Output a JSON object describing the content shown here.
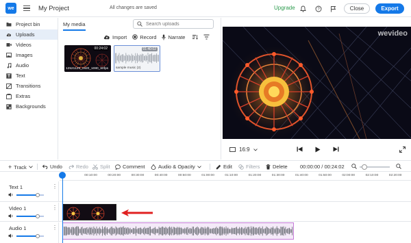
{
  "app": {
    "logo_text": "we",
    "project_title": "My Project",
    "save_status": "All changes are saved",
    "upgrade_label": "Upgrade",
    "close_label": "Close",
    "export_label": "Export"
  },
  "sidebar": {
    "items": [
      {
        "label": "Project bin",
        "icon": "folder-icon",
        "active": false
      },
      {
        "label": "Uploads",
        "icon": "upload-cloud-icon",
        "active": true
      },
      {
        "label": "Videos",
        "icon": "video-icon",
        "active": false
      },
      {
        "label": "Images",
        "icon": "image-icon",
        "active": false
      },
      {
        "label": "Audio",
        "icon": "music-note-icon",
        "active": false
      },
      {
        "label": "Text",
        "icon": "text-icon",
        "active": false
      },
      {
        "label": "Transitions",
        "icon": "transitions-icon",
        "active": false
      },
      {
        "label": "Extras",
        "icon": "extras-icon",
        "active": false
      },
      {
        "label": "Backgrounds",
        "icon": "backgrounds-icon",
        "active": false
      }
    ]
  },
  "media": {
    "tab_label": "My media",
    "search_placeholder": "Search uploads",
    "actions": {
      "import": "Import",
      "record": "Record",
      "narrate": "Narrate"
    },
    "items": [
      {
        "name": "12521129_1920_1080_60fps",
        "duration": "00:24:02",
        "type": "video"
      },
      {
        "name": "sample music (2)",
        "duration": "01:40:02",
        "type": "audio"
      }
    ]
  },
  "preview": {
    "watermark": "wevideo",
    "aspect_ratio": "16:9"
  },
  "timeline_toolbar": {
    "track": "Track",
    "undo": "Undo",
    "redo": "Redo",
    "split": "Split",
    "comment": "Comment",
    "audio_opacity": "Audio & Opacity",
    "edit": "Edit",
    "filters": "Filters",
    "delete": "Delete",
    "timecode": "00:00:00 / 00:24:02"
  },
  "ruler": {
    "ticks": [
      "00",
      "00:10:00",
      "00:20:00",
      "00:30:00",
      "00:40:00",
      "00:50:00",
      "01:00:00",
      "01:10:00",
      "01:20:00",
      "01:30:00",
      "01:40:00",
      "01:50:00",
      "02:00:00",
      "02:10:00",
      "02:20:00"
    ]
  },
  "tracks": [
    {
      "label": "Text 1"
    },
    {
      "label": "Video 1"
    },
    {
      "label": "Audio 1"
    }
  ],
  "colors": {
    "accent": "#1479e8",
    "upgrade": "#2d9b4e",
    "audio_clip_border": "#c57ad8",
    "arrow": "#e02020"
  }
}
